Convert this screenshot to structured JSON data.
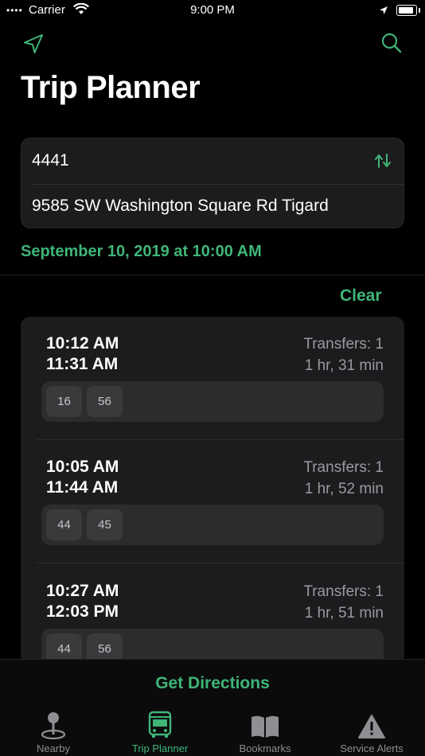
{
  "status_bar": {
    "carrier": "Carrier",
    "time": "9:00 PM"
  },
  "header": {
    "title": "Trip Planner",
    "left_icon": "location-arrow-icon",
    "right_icon": "search-icon"
  },
  "route": {
    "from": "4441",
    "to": "9585 SW Washington Square Rd Tigard",
    "swap_icon": "swap-icon"
  },
  "date": "September 10, 2019 at 10:00 AM",
  "clear_label": "Clear",
  "results": [
    {
      "depart": "10:12 AM",
      "arrive": "11:31 AM",
      "transfers": "Transfers:  1",
      "duration": "1 hr, 31 min",
      "routes": [
        "16",
        "56"
      ]
    },
    {
      "depart": "10:05 AM",
      "arrive": "11:44 AM",
      "transfers": "Transfers:  1",
      "duration": "1 hr, 52 min",
      "routes": [
        "44",
        "45"
      ]
    },
    {
      "depart": "10:27 AM",
      "arrive": "12:03 PM",
      "transfers": "Transfers:  1",
      "duration": "1 hr, 51 min",
      "routes": [
        "44",
        "56"
      ]
    }
  ],
  "get_directions_label": "Get Directions",
  "tabs": [
    {
      "label": "Nearby",
      "icon": "map-pin-icon",
      "active": false
    },
    {
      "label": "Trip Planner",
      "icon": "bus-icon",
      "active": true
    },
    {
      "label": "Bookmarks",
      "icon": "book-icon",
      "active": false
    },
    {
      "label": "Service Alerts",
      "icon": "warning-icon",
      "active": false
    }
  ],
  "colors": {
    "accent": "#3fb578",
    "background": "#000000",
    "card": "#1c1c1e"
  }
}
